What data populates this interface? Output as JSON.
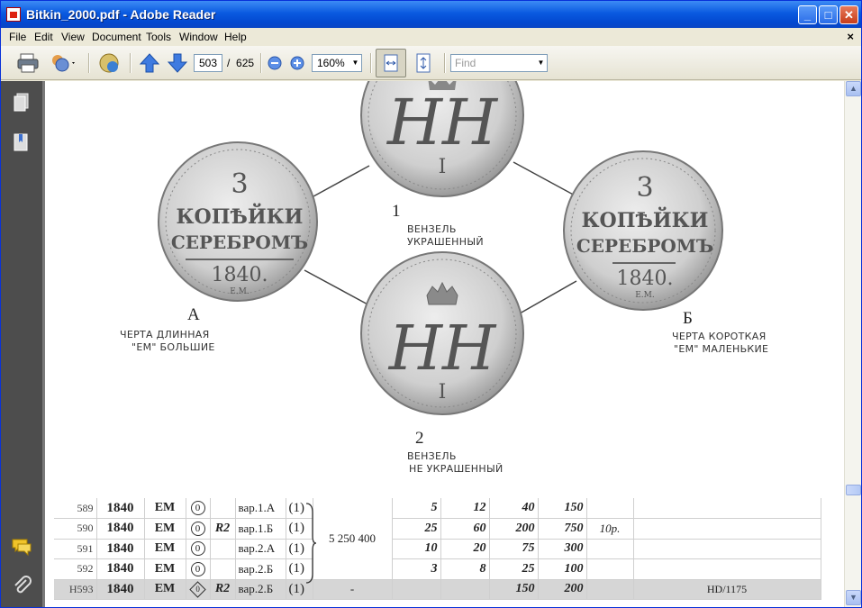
{
  "window": {
    "title": "Bitkin_2000.pdf - Adobe Reader"
  },
  "menu": [
    "File",
    "Edit",
    "View",
    "Document",
    "Tools",
    "Window",
    "Help"
  ],
  "menu_close": "×",
  "toolbar": {
    "page_current": "503",
    "page_separator": "/",
    "page_total": "625",
    "zoom": "160%",
    "find_placeholder": "Find"
  },
  "coin_labels": {
    "coin1_num": "1",
    "coin1_line1": "ВЕНЗЕЛЬ",
    "coin1_line2": "УКРАШЕННЫЙ",
    "coin2_num": "2",
    "coin2_line1": "ВЕНЗЕЛЬ",
    "coin2_line2": "НЕ УКРАШЕННЫЙ",
    "coinA_letter": "А",
    "coinA_line1": "ЧЕРТА ДЛИННАЯ",
    "coinA_line2": "\"ЕМ\" БОЛЬШИЕ",
    "coinB_letter": "Б",
    "coinB_line1": "ЧЕРТА КОРОТКАЯ",
    "coinB_line2": "\"ЕМ\" МАЛЕНЬКИЕ"
  },
  "coin_legend": {
    "denom": "3",
    "word1": "КОПѢЙКИ",
    "word2": "СЕРЕБРОМЪ",
    "year": "1840.",
    "mint": "Е.М."
  },
  "table": {
    "rows": [
      {
        "no": "589",
        "year": "1840",
        "mint": "ЕМ",
        "circ": "0",
        "rarity": "",
        "var": "вар.1.А",
        "n": "(1)",
        "p1": "5",
        "p2": "12",
        "p3": "40",
        "p4": "150",
        "ref": ""
      },
      {
        "no": "590",
        "year": "1840",
        "mint": "ЕМ",
        "circ": "0",
        "rarity": "R2",
        "var": "вар.1.Б",
        "n": "(1)",
        "p1": "25",
        "p2": "60",
        "p3": "200",
        "p4": "750",
        "ref": "10р."
      },
      {
        "no": "591",
        "year": "1840",
        "mint": "ЕМ",
        "circ": "0",
        "rarity": "",
        "var": "вар.2.А",
        "n": "(1)",
        "p1": "10",
        "p2": "20",
        "p3": "75",
        "p4": "300",
        "ref": ""
      },
      {
        "no": "592",
        "year": "1840",
        "mint": "ЕМ",
        "circ": "0",
        "rarity": "",
        "var": "вар.2.Б",
        "n": "(1)",
        "p1": "3",
        "p2": "8",
        "p3": "25",
        "p4": "100",
        "ref": ""
      },
      {
        "no": "Н593",
        "year": "1840",
        "mint": "ЕМ",
        "circ": "0",
        "rarity": "R2",
        "var": "вар.2.Б",
        "n": "(1)",
        "p1": "",
        "p2": "",
        "p3": "150",
        "p4": "200",
        "ref": "HD/1175",
        "dash": "-"
      }
    ],
    "mintage": "5 250 400"
  }
}
